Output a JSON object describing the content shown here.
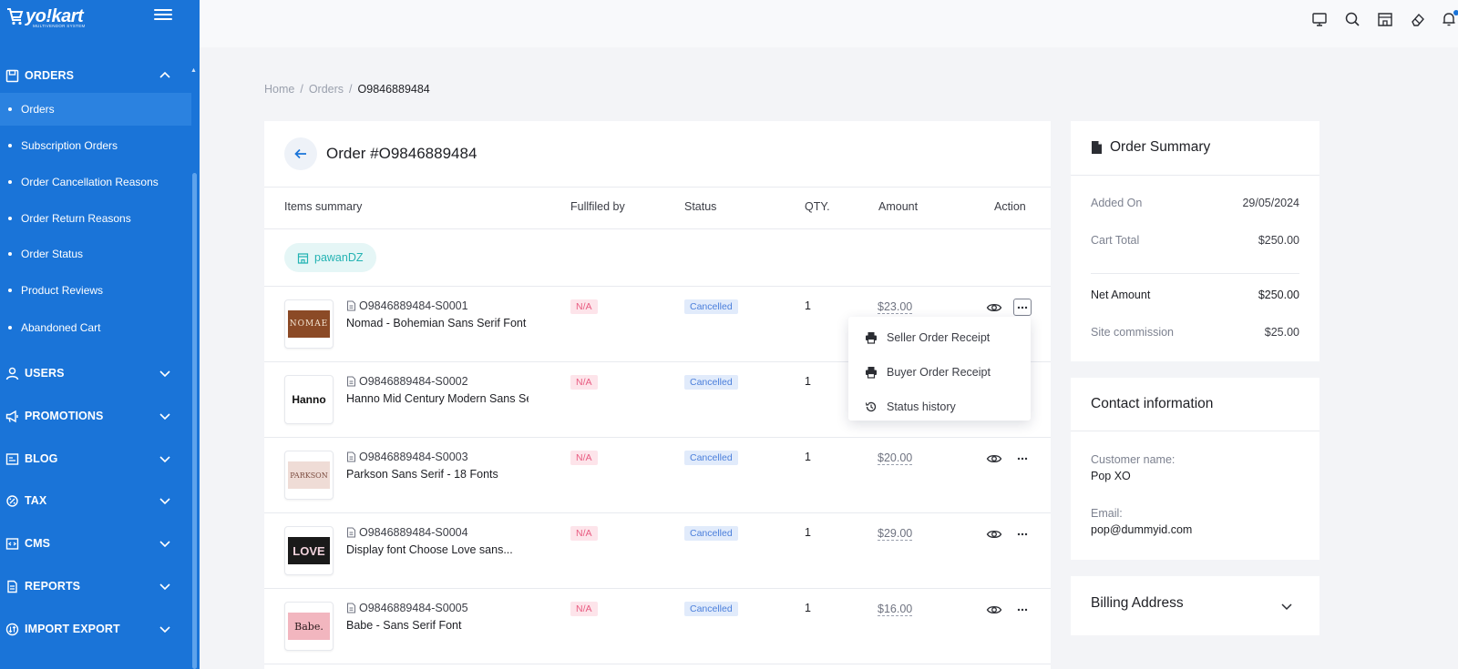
{
  "brand": {
    "name": "yo!kart",
    "tagline": "MULTIVENDOR SYSTEM"
  },
  "sidebar": {
    "orders_section": "ORDERS",
    "order_items": [
      {
        "label": "Orders",
        "active": true
      },
      {
        "label": "Subscription Orders"
      },
      {
        "label": "Order Cancellation Reasons"
      },
      {
        "label": "Order Return Reasons"
      },
      {
        "label": "Order Status"
      },
      {
        "label": "Product Reviews"
      },
      {
        "label": "Abandoned Cart"
      }
    ],
    "sections": [
      {
        "label": "USERS",
        "icon": "user-icon"
      },
      {
        "label": "PROMOTIONS",
        "icon": "megaphone-icon"
      },
      {
        "label": "BLOG",
        "icon": "blog-icon"
      },
      {
        "label": "TAX",
        "icon": "tax-icon"
      },
      {
        "label": "CMS",
        "icon": "code-icon"
      },
      {
        "label": "REPORTS",
        "icon": "report-icon"
      },
      {
        "label": "IMPORT EXPORT",
        "icon": "import-export-icon"
      }
    ]
  },
  "topbar": {
    "icons": [
      "monitor-icon",
      "search-icon",
      "store-icon",
      "eraser-icon",
      "bell-icon"
    ]
  },
  "breadcrumb": {
    "home": "Home",
    "orders": "Orders",
    "current": "O9846889484"
  },
  "order": {
    "title": "Order #O9846889484",
    "columns": {
      "items": "Items summary",
      "fulfilled": "Fullfiled by",
      "status": "Status",
      "qty": "QTY.",
      "amount": "Amount",
      "action": "Action"
    },
    "seller": "pawanDZ",
    "rows": [
      {
        "id": "O9846889484-S0001",
        "name": "Nomad - Bohemian Sans Serif Font",
        "fulfilled": "N/A",
        "status": "Cancelled",
        "qty": "1",
        "amount": "$23.00",
        "thumb": "NOMAE"
      },
      {
        "id": "O9846889484-S0002",
        "name": "Hanno Mid Century Modern Sans Serif",
        "fulfilled": "N/A",
        "status": "Cancelled",
        "qty": "1",
        "amount": "",
        "thumb": "Hanno"
      },
      {
        "id": "O9846889484-S0003",
        "name": "Parkson Sans Serif - 18 Fonts",
        "fulfilled": "N/A",
        "status": "Cancelled",
        "qty": "1",
        "amount": "$20.00",
        "thumb": "PARKSON"
      },
      {
        "id": "O9846889484-S0004",
        "name": "Display font Choose Love sans...",
        "fulfilled": "N/A",
        "status": "Cancelled",
        "qty": "1",
        "amount": "$29.00",
        "thumb": "LOVE"
      },
      {
        "id": "O9846889484-S0005",
        "name": "Babe - Sans Serif Font",
        "fulfilled": "N/A",
        "status": "Cancelled",
        "qty": "1",
        "amount": "$16.00",
        "thumb": "Babe."
      }
    ],
    "menu": {
      "seller_receipt": "Seller Order Receipt",
      "buyer_receipt": "Buyer Order Receipt",
      "status_history": "Status history"
    }
  },
  "summary": {
    "title": "Order Summary",
    "added_on_label": "Added On",
    "added_on": "29/05/2024",
    "cart_total_label": "Cart Total",
    "cart_total": "$250.00",
    "net_amount_label": "Net Amount",
    "net_amount": "$250.00",
    "commission_label": "Site commission",
    "commission": "$25.00"
  },
  "contact": {
    "title": "Contact information",
    "customer_label": "Customer name:",
    "customer": "Pop XO",
    "email_label": "Email:",
    "email": "pop@dummyid.com"
  },
  "billing": {
    "title": "Billing Address"
  },
  "colors": {
    "sidebar": "#1a74d8",
    "accent": "#1a74d8",
    "na": "#e85b81",
    "cancelled": "#4b7fdb",
    "seller": "#24b3b3"
  }
}
